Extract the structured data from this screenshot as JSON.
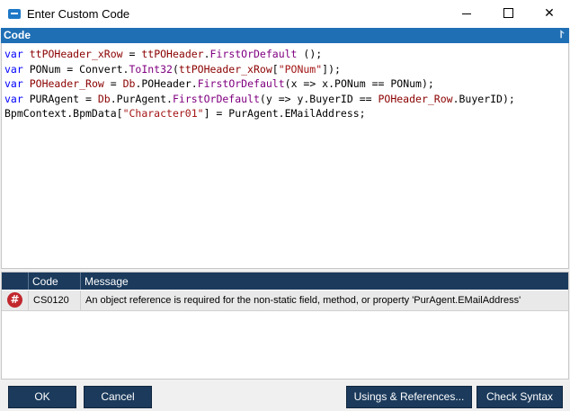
{
  "window": {
    "title": "Enter Custom Code",
    "minimize_glyph": "",
    "close_glyph": "✕"
  },
  "code_panel": {
    "header_label": "Code",
    "pin_icon_glyph": "📌"
  },
  "code_lines": [
    [
      {
        "t": "var",
        "c": "kw"
      },
      {
        "t": " "
      },
      {
        "t": "ttPOHeader_xRow",
        "c": "tok-var"
      },
      {
        "t": " = "
      },
      {
        "t": "ttPOHeader",
        "c": "tok-var"
      },
      {
        "t": "."
      },
      {
        "t": "FirstOrDefault",
        "c": "tok-m"
      },
      {
        "t": " ();"
      }
    ],
    [
      {
        "t": "var",
        "c": "kw"
      },
      {
        "t": " PONum = Convert."
      },
      {
        "t": "ToInt32",
        "c": "tok-m"
      },
      {
        "t": "("
      },
      {
        "t": "ttPOHeader_xRow",
        "c": "tok-var"
      },
      {
        "t": "["
      },
      {
        "t": "\"PONum\"",
        "c": "tok-str"
      },
      {
        "t": "]);"
      }
    ],
    [
      {
        "t": "var",
        "c": "kw"
      },
      {
        "t": " "
      },
      {
        "t": "POHeader_Row",
        "c": "tok-var"
      },
      {
        "t": " = "
      },
      {
        "t": "Db",
        "c": "tok-var"
      },
      {
        "t": ".POHeader."
      },
      {
        "t": "FirstOrDefault",
        "c": "tok-m"
      },
      {
        "t": "(x => x.PONum == PONum);"
      }
    ],
    [
      {
        "t": "var",
        "c": "kw"
      },
      {
        "t": " PURAgent = "
      },
      {
        "t": "Db",
        "c": "tok-var"
      },
      {
        "t": ".PurAgent."
      },
      {
        "t": "FirstOrDefault",
        "c": "tok-m"
      },
      {
        "t": "(y => y.BuyerID == "
      },
      {
        "t": "POHeader_Row",
        "c": "tok-var"
      },
      {
        "t": ".BuyerID);"
      }
    ],
    [
      {
        "t": "BpmContext.BpmData["
      },
      {
        "t": "\"Character01\"",
        "c": "tok-str"
      },
      {
        "t": "] = PurAgent.EMailAddress;"
      }
    ]
  ],
  "errors": {
    "columns": {
      "code": "Code",
      "message": "Message"
    },
    "rows": [
      {
        "icon_glyph": "#",
        "code": "CS0120",
        "message": "An object reference is required for the non-static field, method, or property 'PurAgent.EMailAddress'"
      }
    ]
  },
  "buttons": {
    "ok": "OK",
    "cancel": "Cancel",
    "usings": "Usings & References...",
    "check": "Check Syntax"
  },
  "colors": {
    "accent": "#1f6fb5",
    "header_dark": "#1b3a5c",
    "keyword": "#0000ff",
    "string": "#a31515",
    "error": "#c1272d"
  }
}
